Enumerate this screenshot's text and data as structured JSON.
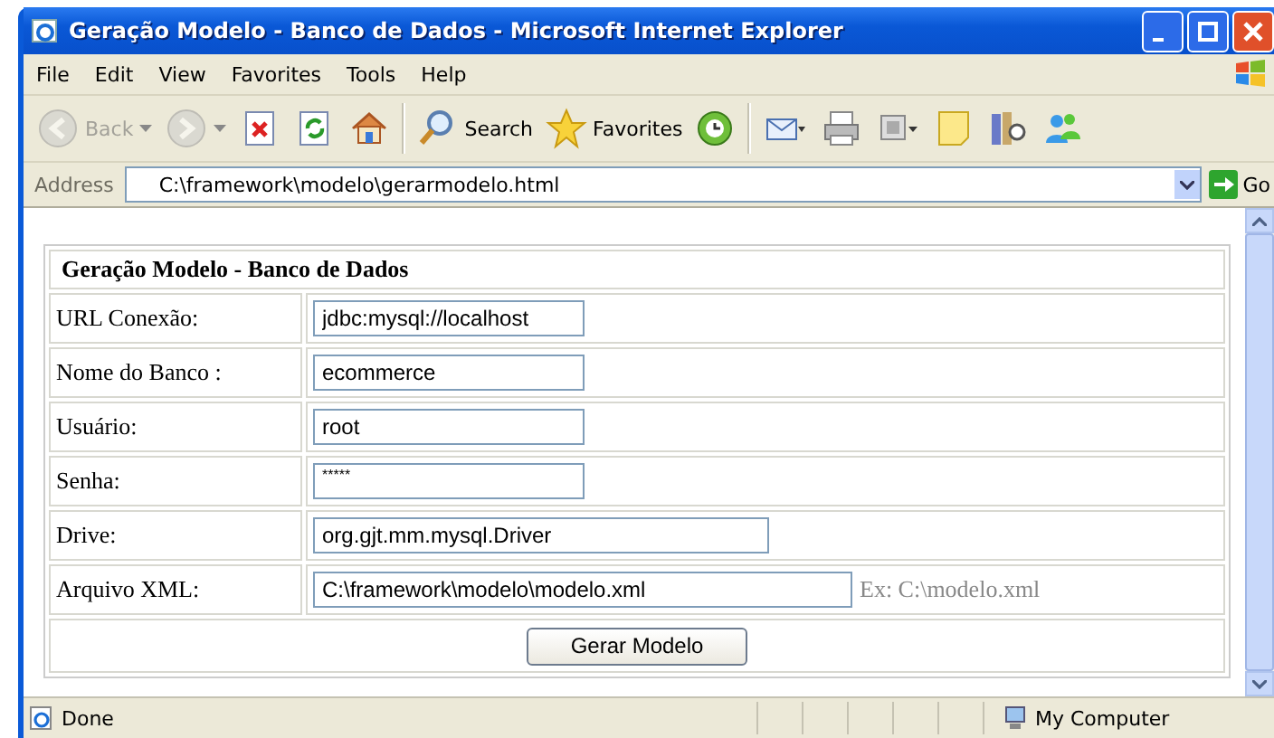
{
  "window": {
    "title": "Geração Modelo - Banco de Dados - Microsoft Internet Explorer"
  },
  "menu": [
    "File",
    "Edit",
    "View",
    "Favorites",
    "Tools",
    "Help"
  ],
  "toolbar": [
    {
      "kind": "back",
      "label": "Back",
      "disabled": true
    },
    {
      "kind": "forward",
      "disabled": true
    },
    {
      "kind": "stop",
      "disabled": false
    },
    {
      "kind": "refresh",
      "disabled": false
    },
    {
      "kind": "home",
      "disabled": false
    },
    {
      "kind": "search",
      "label": "Search",
      "disabled": false
    },
    {
      "kind": "favorites",
      "label": "Favorites",
      "disabled": false
    },
    {
      "kind": "history",
      "disabled": false
    },
    {
      "kind": "mail",
      "disabled": false
    },
    {
      "kind": "print",
      "disabled": false
    },
    {
      "kind": "edit",
      "disabled": false
    },
    {
      "kind": "note",
      "disabled": false
    },
    {
      "kind": "research",
      "disabled": false
    },
    {
      "kind": "messenger",
      "disabled": false
    }
  ],
  "address": {
    "label": "Address",
    "value": "C:\\framework\\modelo\\gerarmodelo.html",
    "go": "Go"
  },
  "form": {
    "title": "Geração Modelo - Banco de Dados",
    "rows": [
      {
        "label": "URL Conexão:",
        "value": "jdbc:mysql://localhost",
        "kind": "short"
      },
      {
        "label": "Nome do Banco :",
        "value": "ecommerce",
        "kind": "short"
      },
      {
        "label": "Usuário:",
        "value": "root",
        "kind": "short"
      },
      {
        "label": "Senha:",
        "value": "*****",
        "kind": "password"
      },
      {
        "label": "Drive:",
        "value": "org.gjt.mm.mysql.Driver",
        "kind": "medium"
      },
      {
        "label": "Arquivo XML:",
        "value": "C:\\framework\\modelo\\modelo.xml",
        "kind": "long",
        "hint": "Ex: C:\\modelo.xml"
      }
    ],
    "button": "Gerar Modelo"
  },
  "status_bar": {
    "text": "Done",
    "zone": "My Computer"
  }
}
